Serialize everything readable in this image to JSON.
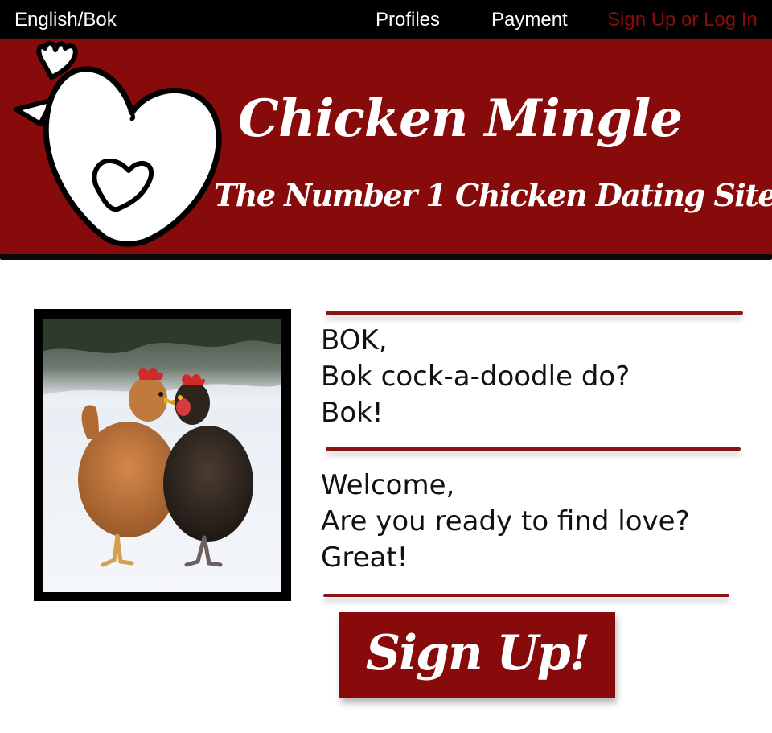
{
  "nav": {
    "language": "English/Bok",
    "profiles": "Profiles",
    "payment": "Payment",
    "signup_login": "Sign Up or Log In"
  },
  "banner": {
    "title": "Chicken Mingle",
    "tagline": "The Number 1 Chicken Dating Site"
  },
  "content": {
    "block1": [
      "BOK,",
      "Bok cock-a-doodle do?",
      "Bok!"
    ],
    "block2": [
      "Welcome,",
      "Are you ready to find love?",
      "Great!"
    ]
  },
  "cta": {
    "label": "Sign Up!"
  },
  "colors": {
    "brand_red": "#880b0b",
    "nav_bg": "#000000",
    "nav_accent": "#8b0c0c"
  },
  "icons": {
    "logo": "chicken-heart-logo"
  }
}
